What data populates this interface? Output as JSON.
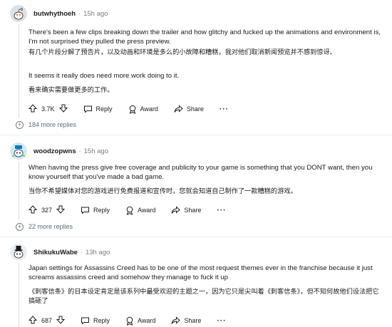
{
  "comments": [
    {
      "username": "butwhythoeh",
      "time": "15h ago",
      "paragraphs": [
        "There's been a few clips breaking down the trailer and how glitchy and fucked up the animations and environment is, I'm not surprised they pulled the press preview.",
        "有几个片段分解了预告片，以及动画和环境是多么的小故障和糟糕，我对他们取消新闻预览并不感到惊讶。",
        "It seems it really does need more work doing to it.",
        "看来确实需要做更多的工作。"
      ],
      "votes": "3.7K",
      "reply_label": "Reply",
      "award_label": "Award",
      "share_label": "Share",
      "more_label": "···",
      "more_replies": "184 more replies"
    },
    {
      "username": "woodzopwns",
      "time": "15h ago",
      "paragraphs": [
        "When having the press give free coverage and publicity to your game is something that you DONT want, then you know yourself that you've made a bad game.",
        "当你不希望媒体对您的游戏进行免费报道和宣传时，您就会知道自己制作了一款糟糕的游戏。"
      ],
      "votes": "327",
      "reply_label": "Reply",
      "award_label": "Award",
      "share_label": "Share",
      "more_label": "···",
      "more_replies": "22 more replies"
    },
    {
      "username": "ShikukuWabe",
      "time": "13h ago",
      "paragraphs": [
        "Japan settings for Assassins Creed has to be one of the most request themes ever in the franchise because it just screams assassins creed and somehow they manage to fuck it up",
        "《刺客信条》的日本设定肯定是该系列中最受欢迎的主题之一，因为它只是尖叫着《刺客信条》，但不知何故他们设法把它搞砸了"
      ],
      "votes": "687",
      "reply_label": "Reply",
      "award_label": "Award",
      "share_label": "Share",
      "more_label": "···"
    }
  ],
  "dot_separator": "·",
  "colors": {
    "meta_gray": "#787c7e",
    "thread_line": "#d7dadc",
    "avatar_bg_1": "#dae0e6",
    "avatar_bg_2": "#cfe9f5",
    "avatar_bg_3": "#e8eef2"
  }
}
